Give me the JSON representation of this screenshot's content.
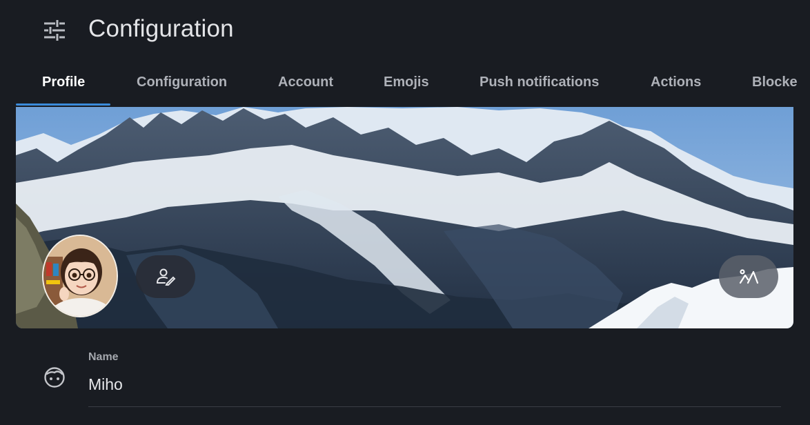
{
  "header": {
    "title": "Configuration",
    "icon": "tune-sliders-icon"
  },
  "tabs": [
    {
      "label": "Profile",
      "active": true
    },
    {
      "label": "Configuration",
      "active": false
    },
    {
      "label": "Account",
      "active": false
    },
    {
      "label": "Emojis",
      "active": false
    },
    {
      "label": "Push notifications",
      "active": false
    },
    {
      "label": "Actions",
      "active": false
    },
    {
      "label": "Blocke",
      "active": false
    }
  ],
  "profile": {
    "banner_image": "snowy-mountain-range-panorama",
    "avatar_image": "cartoon-girl-with-glasses",
    "edit_avatar_icon": "person-edit-icon",
    "edit_banner_icon": "landscape-edit-icon",
    "name_field": {
      "label": "Name",
      "value": "Miho",
      "icon": "face-icon"
    }
  },
  "colors": {
    "background": "#191c22",
    "accent": "#3b8bdb",
    "tab_inactive": "#aeb1b8"
  }
}
